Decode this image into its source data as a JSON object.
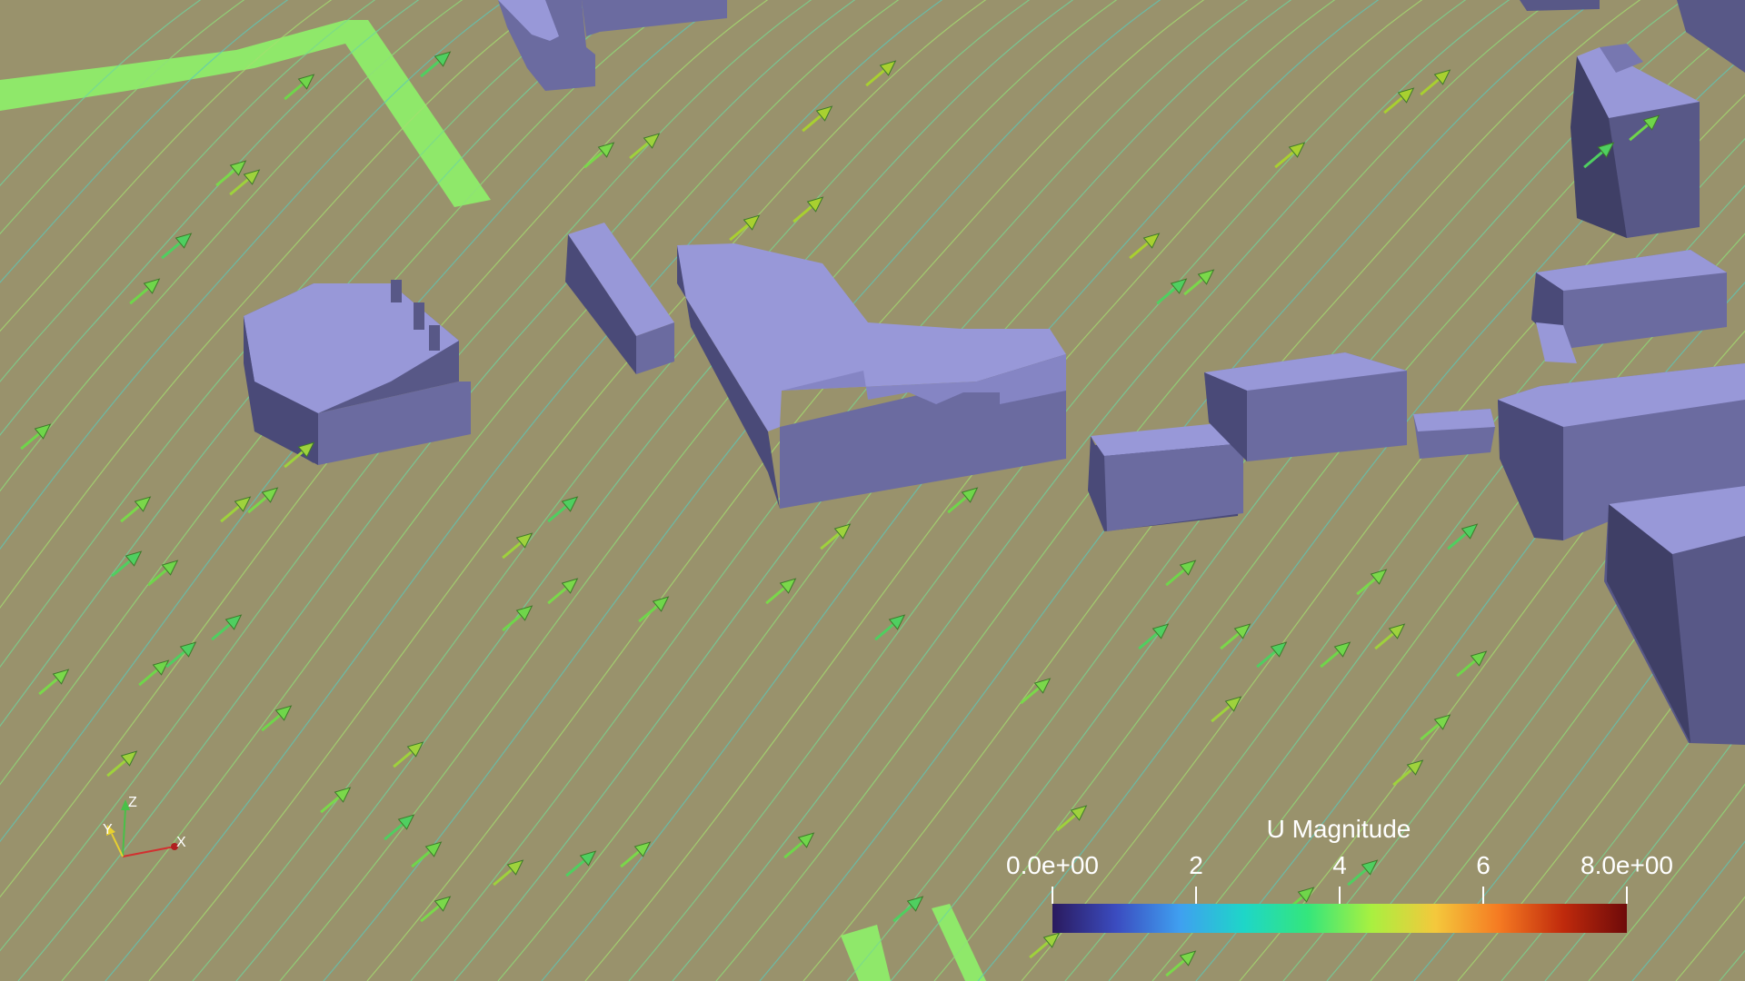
{
  "colors": {
    "ground": "#99926c",
    "building_top": "#9898d8",
    "building_side": "#585887",
    "building_dark": "#3f3f66",
    "road": "#8fe86a",
    "streamline": "#6ed6a0",
    "arrow": "#6fd64a"
  },
  "colorbar": {
    "title": "U Magnitude",
    "ticks": [
      "0.0e+00",
      "2",
      "4",
      "6",
      "8.0e+00"
    ],
    "tick_values": [
      0,
      2,
      4,
      6,
      8
    ],
    "range": [
      0,
      8
    ],
    "colormap": [
      "#2a1a5e",
      "#3b4cc0",
      "#3fa0f0",
      "#1ed6c8",
      "#34e67c",
      "#a9f040",
      "#f4c83c",
      "#f57a22",
      "#c02a0c",
      "#6e0a0a"
    ]
  },
  "axes": {
    "x_label": "X",
    "y_label": "Y",
    "z_label": "Z"
  }
}
